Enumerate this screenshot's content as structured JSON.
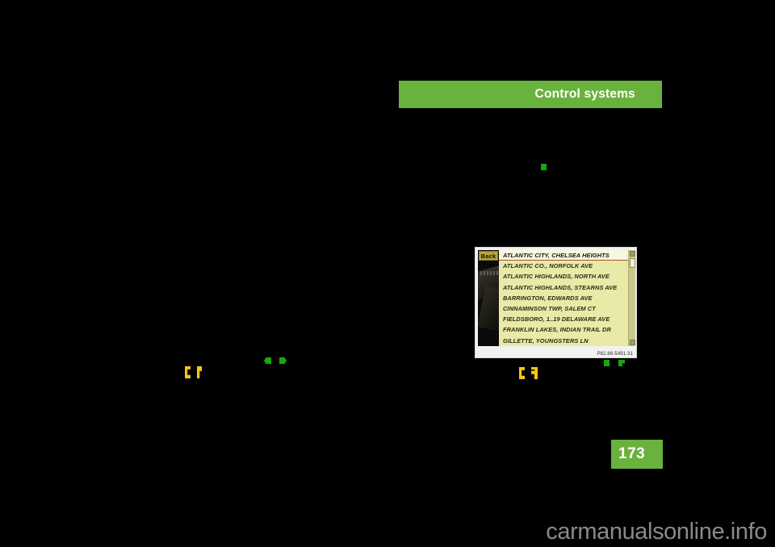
{
  "page": {
    "number": "173",
    "section_title": "Control systems",
    "watermark": "carmanualsonline.info",
    "accent_color": "#6ab23e",
    "background_color": "#000000"
  },
  "figure": {
    "caption": "P82.86-5491-31",
    "back_button_label": "Back",
    "selected_entry": "ATLANTIC CITY, CHELSEA HEIGHTS",
    "entries": [
      "ATLANTIC CO., NORFOLK AVE",
      "ATLANTIC HIGHLANDS, NORTH AVE",
      "ATLANTIC HIGHLANDS, STEARNS AVE",
      "BARRINGTON, EDWARDS AVE",
      "CINNAMINSON TWP, SALEM CT",
      "FIELDSBORO, 1..19 DELAWARE AVE",
      "FRANKLIN LAKES, INDIAN TRAIL DR",
      "GILLETTE, YOUNGSTERS LN"
    ],
    "screen_background_color": "#e9e9a8",
    "selected_row_color": "#f7f7e2",
    "selected_underline_color": "#a8542a",
    "back_button_color": "#b8a43a"
  },
  "markers": {
    "green_color": "#17a80d",
    "yellow_color": "#f5c518",
    "green_square_top": "green-square-marker",
    "green_pointer_left": "green-pointer-left-marker",
    "green_pointer_right": "green-pointer-right-marker",
    "yellow_bracket_left": "yellow-bracket-left-marker",
    "yellow_bracket_right": "yellow-bracket-right-marker",
    "green_square_right": "green-square-marker",
    "green_flag_right": "green-flag-marker"
  }
}
